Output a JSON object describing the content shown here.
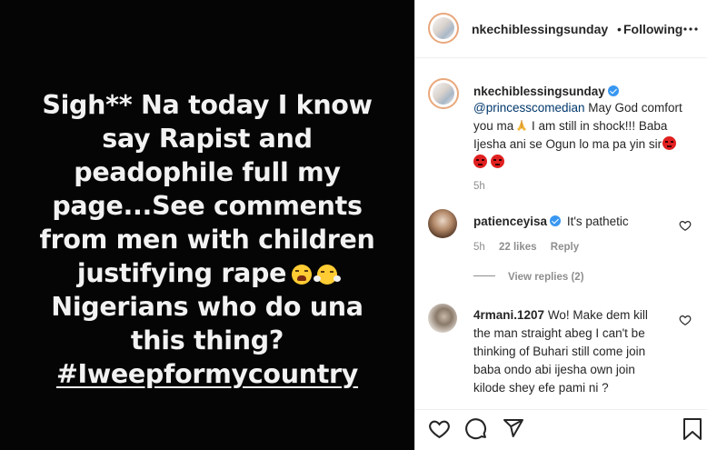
{
  "post": {
    "lines": [
      "Sigh** Na today I know",
      "say Rapist and",
      "peadophile full my",
      "page...See comments",
      "from men with children",
      "justifying rape",
      "Nigerians who do una",
      "this thing?",
      "#Iweepformycountry"
    ]
  },
  "header": {
    "username": "nkechiblessingsunday",
    "dot": "•",
    "follow_status": "Following",
    "more_icon": "more-horizontal-icon"
  },
  "caption": {
    "username": "nkechiblessingsunday",
    "mention": "@princesscomedian",
    "line1_rest": " May God comfort",
    "line2": "you ma",
    "line2_rest": " I am still in shock!!! Baba",
    "line3": "Ijesha ani se Ogun lo ma pa yin sir",
    "time": "5h"
  },
  "comments": [
    {
      "username": "patienceyisa",
      "text": "It's pathetic",
      "time": "5h",
      "likes": "22 likes",
      "reply": "Reply",
      "view_replies": "View replies (2)"
    },
    {
      "username": "4rmani.1207",
      "line1": "Wo! Make dem kill",
      "line2": "the man straight abeg I can't be",
      "line3": "thinking of Buhari still come join",
      "line4": "baba ondo abi ijesha own join",
      "line5": "kilode shey efe pami ni ?"
    }
  ],
  "actions": {
    "icons": [
      "heart-icon",
      "comment-icon",
      "share-icon",
      "bookmark-icon"
    ]
  },
  "colors": {
    "verified": "#3897f0",
    "link": "#00376b",
    "meta": "#8e8e8e"
  }
}
